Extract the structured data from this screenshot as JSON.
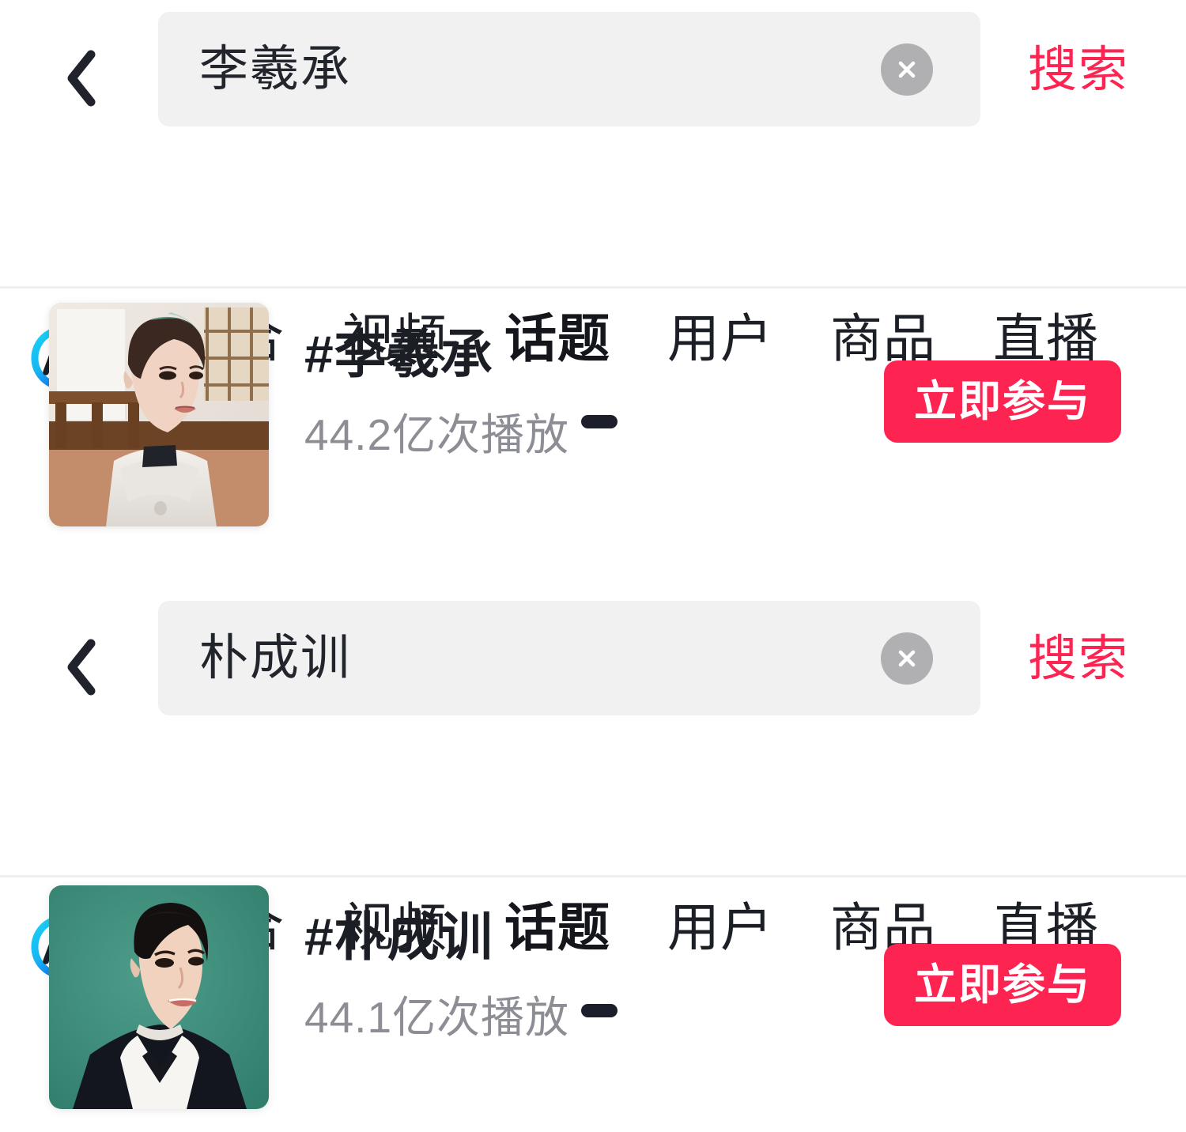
{
  "brand": {
    "accent_color": "#fe2452",
    "ai_icon_gradient_from": "#18d0f5",
    "ai_icon_gradient_to": "#1565f0",
    "ai_icon_label": "Ai"
  },
  "sections": [
    {
      "search": {
        "back_icon": "chevron-left-icon",
        "query": "李羲承",
        "placeholder": "搜索",
        "clear_icon": "clear-circle-icon",
        "action_label": "搜索"
      },
      "tabbar": {
        "ai_icon": "ai-search-icon",
        "tabs": [
          {
            "label": "综合",
            "active": false
          },
          {
            "label": "视频",
            "active": false
          },
          {
            "label": "话题",
            "active": true
          },
          {
            "label": "用户",
            "active": false
          },
          {
            "label": "商品",
            "active": false
          },
          {
            "label": "直播",
            "active": false
          }
        ]
      },
      "result": {
        "thumbnail_alt": "person-white-hoodie-wooden-room",
        "title": "#李羲承",
        "plays": "44.2亿次播放",
        "cta_label": "立即参与"
      }
    },
    {
      "search": {
        "back_icon": "chevron-left-icon",
        "query": "朴成训",
        "placeholder": "搜索",
        "clear_icon": "clear-circle-icon",
        "action_label": "搜索"
      },
      "tabbar": {
        "ai_icon": "ai-search-icon",
        "tabs": [
          {
            "label": "综合",
            "active": false
          },
          {
            "label": "视频",
            "active": false
          },
          {
            "label": "话题",
            "active": true
          },
          {
            "label": "用户",
            "active": false
          },
          {
            "label": "商品",
            "active": false
          },
          {
            "label": "直播",
            "active": false
          }
        ]
      },
      "result": {
        "thumbnail_alt": "person-black-blazer-green-background",
        "title": "#朴成训",
        "plays": "44.1亿次播放",
        "cta_label": "立即参与"
      }
    }
  ]
}
